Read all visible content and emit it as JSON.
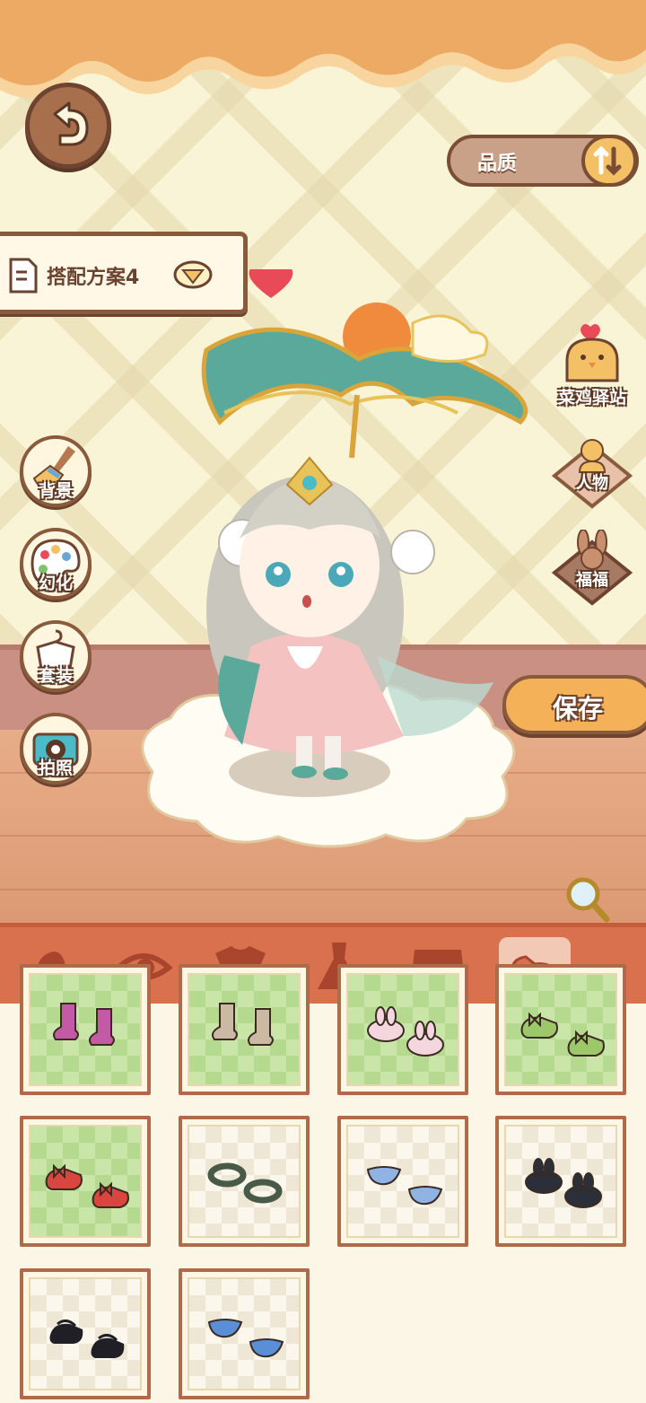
{
  "header": {
    "quality_label": "品质",
    "outfit_label": "搭配方案4"
  },
  "left_menu": [
    {
      "label": "背景",
      "icon": "broom-icon"
    },
    {
      "label": "幻化",
      "icon": "palette-icon"
    },
    {
      "label": "套装",
      "icon": "hanger-shirt-icon"
    },
    {
      "label": "拍照",
      "icon": "camera-icon"
    }
  ],
  "right_menu": [
    {
      "label": "菜鸡驿站",
      "icon": "chick-station-icon"
    },
    {
      "label": "人物",
      "icon": "person-icon"
    },
    {
      "label": "福福",
      "icon": "rabbit-icon"
    }
  ],
  "save_label": "保存",
  "category_tabs": [
    {
      "icon": "hair-icon",
      "active": false
    },
    {
      "icon": "eye-icon",
      "active": false
    },
    {
      "icon": "shirt-icon",
      "active": false
    },
    {
      "icon": "dress-icon",
      "active": false
    },
    {
      "icon": "shorts-icon",
      "active": false
    },
    {
      "icon": "shoes-icon",
      "active": true
    }
  ],
  "items": [
    {
      "bg": "green",
      "color": "#c35aa6",
      "style": "boots"
    },
    {
      "bg": "green",
      "color": "#cbb9a4",
      "style": "boots"
    },
    {
      "bg": "green",
      "color": "#f4d6de",
      "style": "bunny"
    },
    {
      "bg": "green",
      "color": "#9cc86a",
      "style": "bow"
    },
    {
      "bg": "green",
      "color": "#d9453f",
      "style": "bow"
    },
    {
      "bg": "plain",
      "color": "#4a5a48",
      "style": "ring"
    },
    {
      "bg": "plain",
      "color": "#8fb3e3",
      "style": "flat"
    },
    {
      "bg": "plain",
      "color": "#2b2f3a",
      "style": "bunny"
    },
    {
      "bg": "plain",
      "color": "#1f1f25",
      "style": "mary"
    },
    {
      "bg": "plain",
      "color": "#5a8ed6",
      "style": "flat"
    }
  ],
  "colors": {
    "wall": "#faf4d6",
    "top_band": "#ecaa64",
    "floor": "#e7ad88",
    "tab_bar": "#d9714f",
    "cell_border": "#b06a4a",
    "button_dark": "#8a5a3c",
    "save_button": "#f4b158"
  }
}
